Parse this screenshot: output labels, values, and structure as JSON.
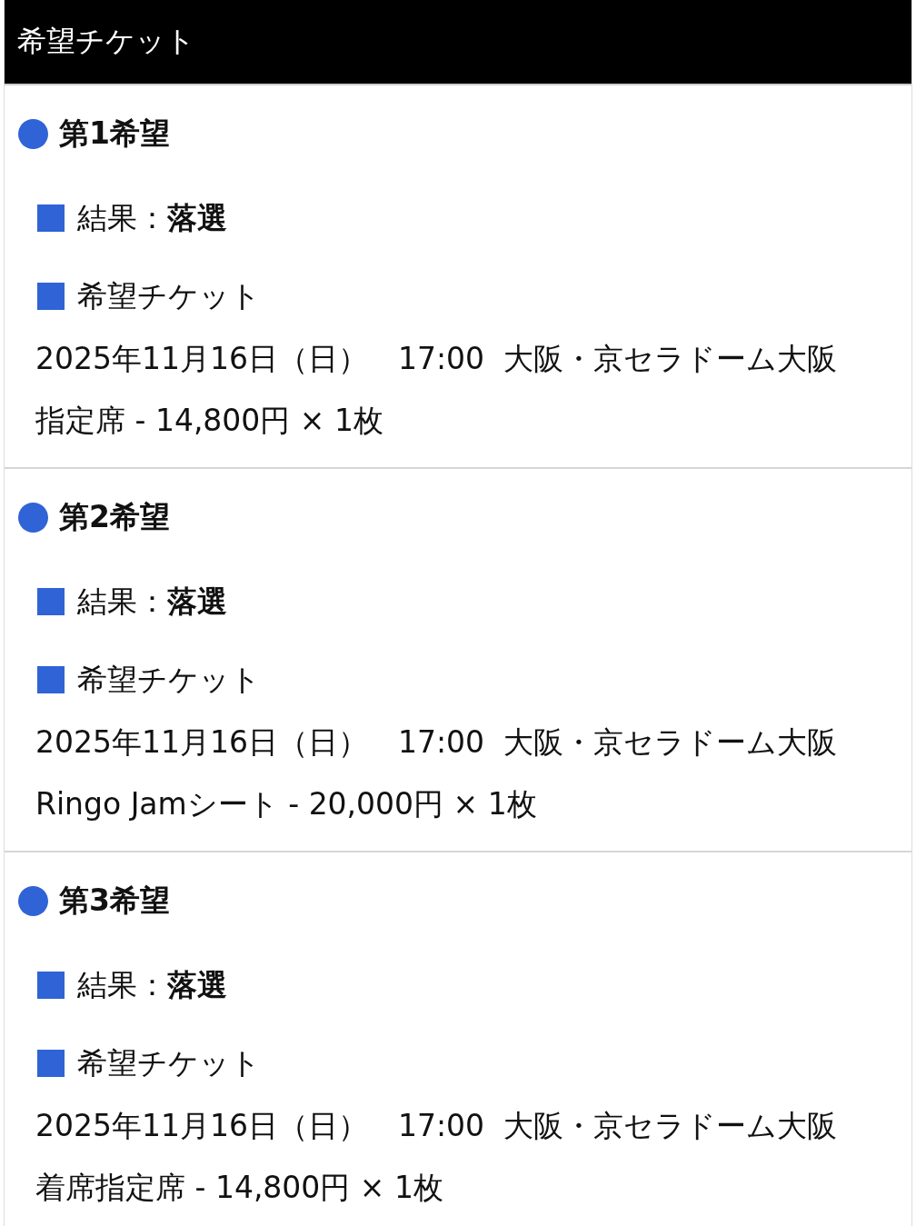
{
  "header": {
    "title": "希望チケット"
  },
  "preferences": [
    {
      "heading": "第1希望",
      "result": "結果：**落選**",
      "ticket_heading": "希望チケット",
      "performance": "2025年11月16日（日）　17:00  大阪・京セラドーム大阪",
      "seat": "指定席 - 14,800円 × 1枚"
    },
    {
      "heading": "第2希望",
      "result": "結果：**落選**",
      "ticket_heading": "希望チケット",
      "performance": "2025年11月16日（日）　17:00  大阪・京セラドーム大阪",
      "seat": "Ringo Jamシート - 20,000円 × 1枚"
    },
    {
      "heading": "第3希望",
      "result": "結果：**落選**",
      "ticket_heading": "希望チケット",
      "performance": "2025年11月16日（日）　17:00  大阪・京セラドーム大阪",
      "seat": "着席指定席 - 14,800円 × 1枚"
    }
  ]
}
